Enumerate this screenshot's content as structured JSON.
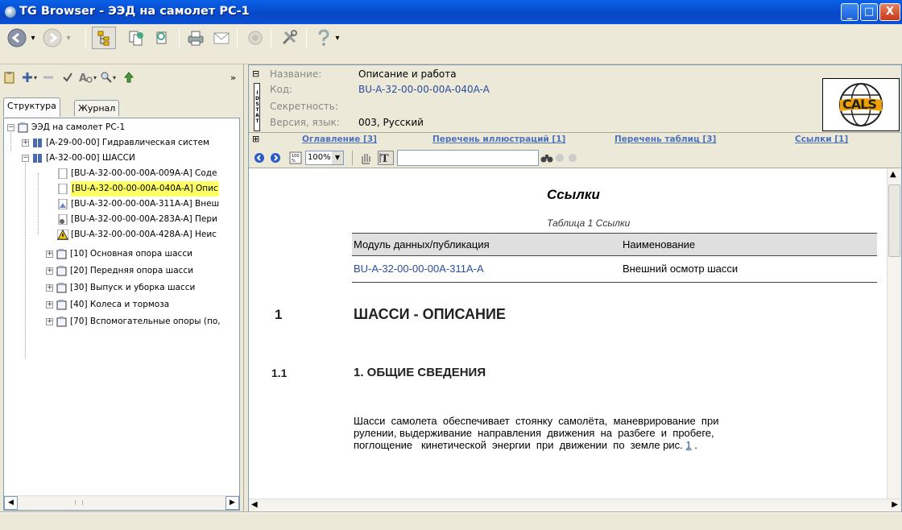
{
  "window": {
    "title": "TG Browser - ЭЭД на самолет РС-1",
    "minimize_glyph": "_",
    "restore_glyph": "□",
    "close_glyph": "X"
  },
  "toolbar": {
    "icons": [
      "back-icon",
      "forward-icon",
      "tree-view-icon",
      "copy-doc-icon",
      "properties-icon",
      "print-icon",
      "mail-icon",
      "stop-icon",
      "tools-icon",
      "help-icon"
    ]
  },
  "left_toolbar": {
    "expand_glyph": "»"
  },
  "tabs": [
    {
      "label": "Структура"
    },
    {
      "label": "Журнал"
    }
  ],
  "tree": {
    "items": [
      {
        "label": "ЭЭД на самолет РС-1",
        "pm": "−"
      },
      {
        "label": "[A-29-00-00] Гидравлическая систем",
        "pm": "+"
      },
      {
        "label": "[A-32-00-00] ШАССИ",
        "pm": "−"
      },
      {
        "label": "[BU-A-32-00-00-00A-009A-A] Соде"
      },
      {
        "label": "[BU-A-32-00-00-00A-040A-A] Опис"
      },
      {
        "label": "[BU-A-32-00-00-00A-311A-A] Внеш"
      },
      {
        "label": "[BU-A-32-00-00-00A-283A-A] Пери"
      },
      {
        "label": "[BU-A-32-00-00-00A-428A-A] Неис"
      },
      {
        "label": "[10] Основная опора шасси",
        "pm": "+"
      },
      {
        "label": "[20] Передняя опора шасси",
        "pm": "+"
      },
      {
        "label": "[30] Выпуск и уборка шасси",
        "pm": "+"
      },
      {
        "label": "[40] Колеса и тормоза",
        "pm": "+"
      },
      {
        "label": "[70] Вспомогательные опоры (по,",
        "pm": "+"
      }
    ]
  },
  "doc_header": {
    "collapse_glyph": "⊟",
    "expand_glyph": "⊞",
    "idstatus_label": "IDSTAT",
    "fields": [
      {
        "label": "Название:",
        "value": "Описание и работа"
      },
      {
        "label": "Код:",
        "value": "BU-A-32-00-00-00A-040A-A"
      },
      {
        "label": "Секретность:",
        "value": ""
      },
      {
        "label": "Версия, язык:",
        "value": "003,  Русский"
      }
    ],
    "logo_text": "CALS",
    "nav_links": [
      {
        "label": "Оглавление [3]"
      },
      {
        "label": "Перечень иллюстраций [1]"
      },
      {
        "label": "Перечень таблиц [3]"
      },
      {
        "label": "Ссылки [1]"
      }
    ]
  },
  "doc_toolbar": {
    "zoom_value": "100%",
    "search_value": "",
    "search_placeholder": ""
  },
  "content": {
    "refs_title": "Ссылки",
    "table_caption": "Таблица 1   Ссылки",
    "table": {
      "columns": [
        "Модуль данных/публикация",
        "Наименование"
      ],
      "rows": [
        [
          "BU-A-32-00-00-00A-311A-A",
          "Внешний осмотр шасси"
        ]
      ]
    },
    "sections": [
      {
        "num": "1",
        "title": "ШАССИ   -   ОПИСАНИЕ"
      },
      {
        "num": "1.1",
        "title": "1.  ОБЩИЕ   СВЕДЕНИЯ"
      }
    ],
    "paragraph_lines": [
      "Шасси  самолета  обеспечивает  стоянку  самолёта,  маневрирование  при",
      "рулении, выдерживание  направления  движения  на  разбеге  и  пробеге,",
      "поглощение   кинетической  энергии  при  движении  по  земле рис."
    ],
    "fig_ref": "1",
    "fig_ref_tail": " ."
  },
  "status": {
    "text": ""
  }
}
